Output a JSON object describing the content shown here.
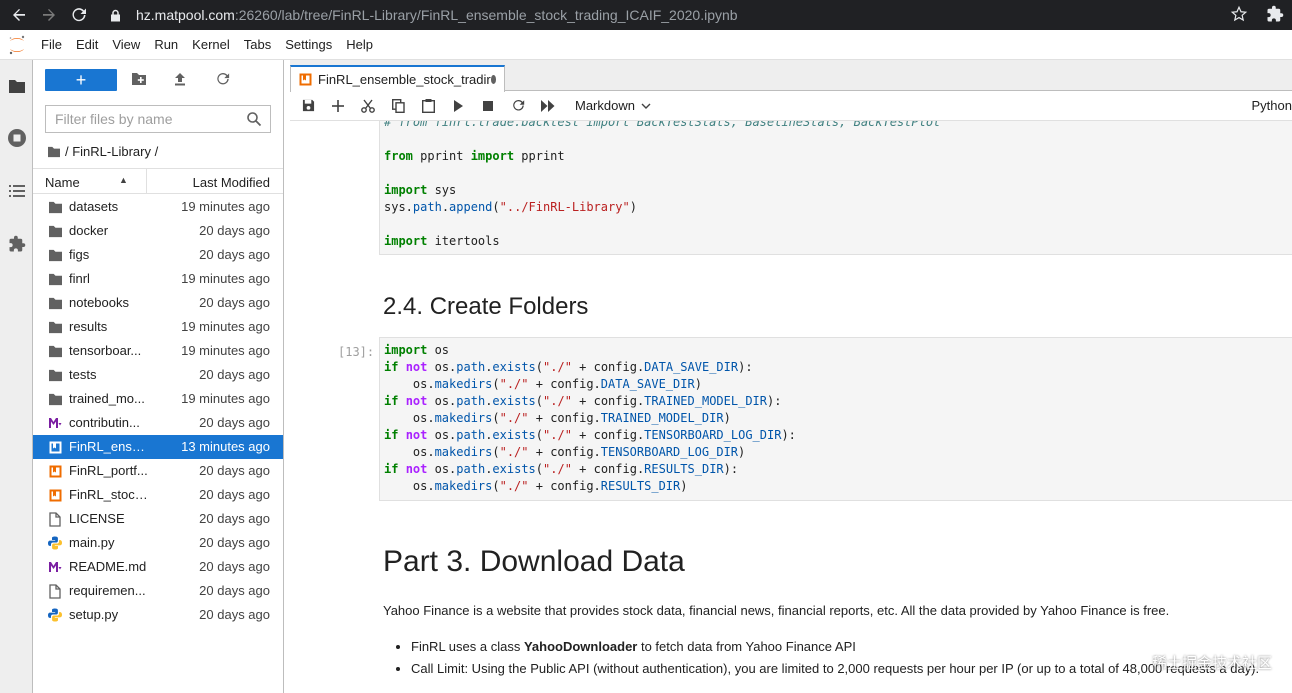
{
  "browser": {
    "url_host": "hz.matpool.com",
    "url_rest": ":26260/lab/tree/FinRL-Library/FinRL_ensemble_stock_trading_ICAIF_2020.ipynb"
  },
  "menu": [
    "File",
    "Edit",
    "View",
    "Run",
    "Kernel",
    "Tabs",
    "Settings",
    "Help"
  ],
  "filebrowser": {
    "filter_placeholder": "Filter files by name",
    "breadcrumb": "/ FinRL-Library /",
    "col_name": "Name",
    "col_modified": "Last Modified",
    "files": [
      {
        "name": "datasets",
        "modified": "19 minutes ago",
        "icon": "folder-icon"
      },
      {
        "name": "docker",
        "modified": "20 days ago",
        "icon": "folder-icon"
      },
      {
        "name": "figs",
        "modified": "20 days ago",
        "icon": "folder-icon"
      },
      {
        "name": "finrl",
        "modified": "19 minutes ago",
        "icon": "folder-icon"
      },
      {
        "name": "notebooks",
        "modified": "20 days ago",
        "icon": "folder-icon"
      },
      {
        "name": "results",
        "modified": "19 minutes ago",
        "icon": "folder-icon"
      },
      {
        "name": "tensorboar...",
        "modified": "19 minutes ago",
        "icon": "folder-icon"
      },
      {
        "name": "tests",
        "modified": "20 days ago",
        "icon": "folder-icon"
      },
      {
        "name": "trained_mo...",
        "modified": "19 minutes ago",
        "icon": "folder-icon"
      },
      {
        "name": "contributin...",
        "modified": "20 days ago",
        "icon": "markdown-icon"
      },
      {
        "name": "FinRL_ense...",
        "modified": "13 minutes ago",
        "icon": "notebook-icon",
        "selected": true
      },
      {
        "name": "FinRL_portf...",
        "modified": "20 days ago",
        "icon": "notebook-icon"
      },
      {
        "name": "FinRL_stock...",
        "modified": "20 days ago",
        "icon": "notebook-icon"
      },
      {
        "name": "LICENSE",
        "modified": "20 days ago",
        "icon": "file-icon"
      },
      {
        "name": "main.py",
        "modified": "20 days ago",
        "icon": "python-icon"
      },
      {
        "name": "README.md",
        "modified": "20 days ago",
        "icon": "markdown-icon"
      },
      {
        "name": "requiremen...",
        "modified": "20 days ago",
        "icon": "file-icon"
      },
      {
        "name": "setup.py",
        "modified": "20 days ago",
        "icon": "python-icon"
      }
    ]
  },
  "notebook": {
    "tab_title": "FinRL_ensemble_stock_tradir",
    "cell_type": "Markdown",
    "kernel": "Python",
    "cell1_lines": [
      "# from finrl.trade.backtest import BackTestStats, BaselineStats, BackTestPlot",
      "",
      "from pprint import pprint",
      "",
      "import sys",
      "sys.path.append(\"../FinRL-Library\")",
      "",
      "import itertools"
    ],
    "heading1": "2.4. Create Folders",
    "cell2_prompt": "[13]:",
    "cell2_lines": [
      "import os",
      "if not os.path.exists(\"./\" + config.DATA_SAVE_DIR):",
      "    os.makedirs(\"./\" + config.DATA_SAVE_DIR)",
      "if not os.path.exists(\"./\" + config.TRAINED_MODEL_DIR):",
      "    os.makedirs(\"./\" + config.TRAINED_MODEL_DIR)",
      "if not os.path.exists(\"./\" + config.TENSORBOARD_LOG_DIR):",
      "    os.makedirs(\"./\" + config.TENSORBOARD_LOG_DIR)",
      "if not os.path.exists(\"./\" + config.RESULTS_DIR):",
      "    os.makedirs(\"./\" + config.RESULTS_DIR)"
    ],
    "heading2": "Part 3. Download Data",
    "para": "Yahoo Finance is a website that provides stock data, financial news, financial reports, etc. All the data provided by Yahoo Finance is free.",
    "bullet1_pre": "FinRL uses a class ",
    "bullet1_bold": "YahooDownloader",
    "bullet1_post": " to fetch data from Yahoo Finance API",
    "bullet2": "Call Limit: Using the Public API (without authentication), you are limited to 2,000 requests per hour per IP (or up to a total of 48,000 requests a day)."
  },
  "watermark": "稀土掘金技术社区",
  "colors": {
    "accent": "#1976d2",
    "browser_bg": "#202124"
  }
}
